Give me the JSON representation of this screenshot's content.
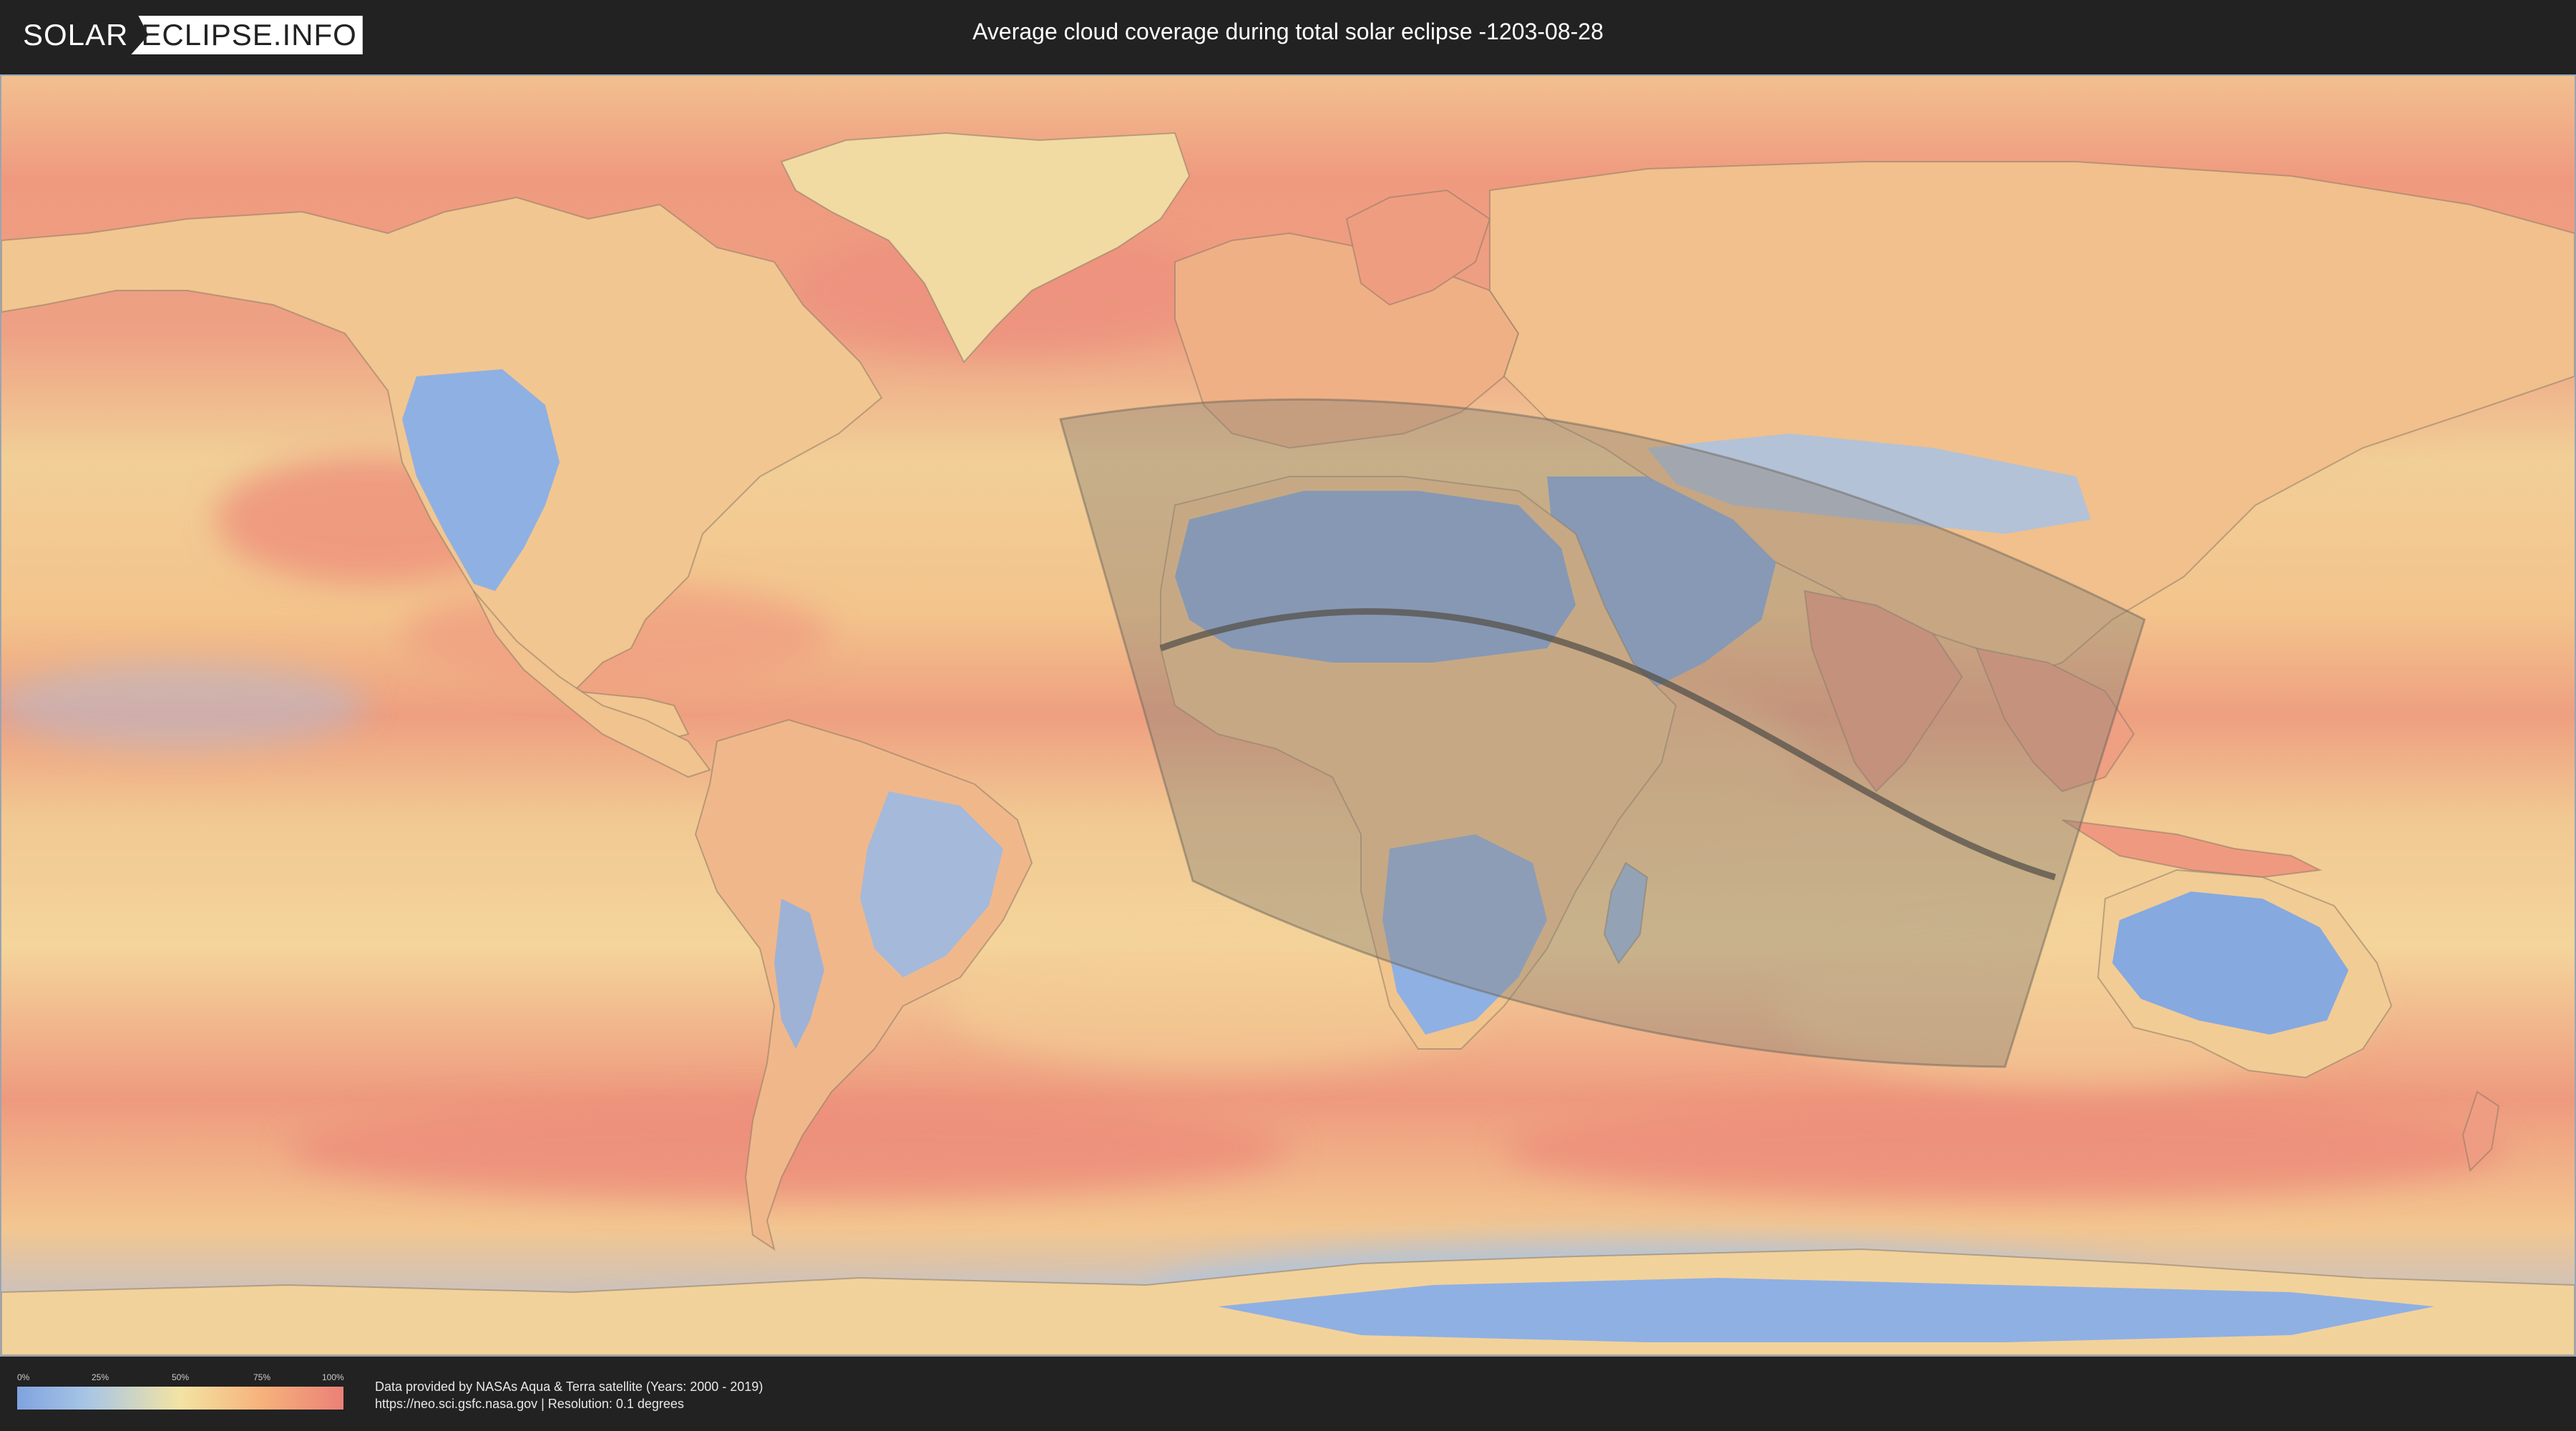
{
  "header": {
    "logo_left": "SOLAR",
    "logo_right": "ECLIPSE.INFO",
    "title": "Average cloud coverage during total solar eclipse -1203-08-28"
  },
  "legend": {
    "ticks": [
      "0%",
      "25%",
      "50%",
      "75%",
      "100%"
    ],
    "colors": {
      "low": "#7fa3e0",
      "mid": "#f3e3a3",
      "high": "#eb8077"
    }
  },
  "footer": {
    "credit_line1": "Data provided by NASAs Aqua & Terra satellite (Years: 2000 - 2019)",
    "credit_line2": "https://neo.sci.gsfc.nasa.gov | Resolution: 0.1 degrees"
  }
}
